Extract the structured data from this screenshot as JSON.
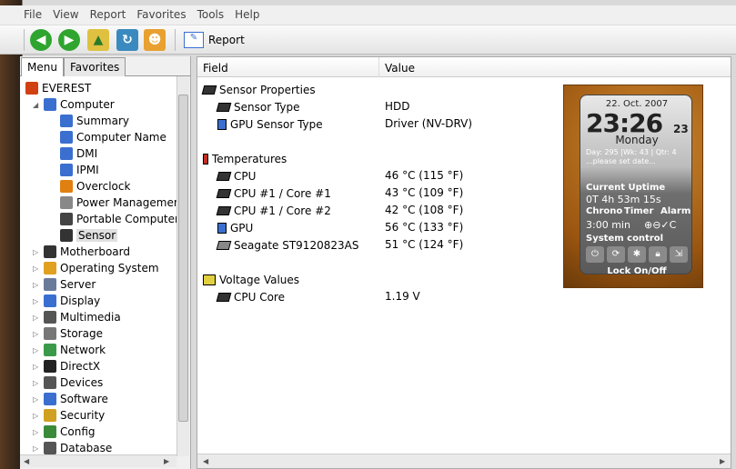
{
  "menu": [
    "File",
    "View",
    "Report",
    "Favorites",
    "Tools",
    "Help"
  ],
  "toolbar": {
    "report_label": "Report"
  },
  "left_tabs": [
    "Menu",
    "Favorites"
  ],
  "tree": [
    {
      "label": "EVEREST",
      "level": 0,
      "icon": "info-icon",
      "color": "#d04010"
    },
    {
      "label": "Computer",
      "level": 1,
      "icon": "computer-icon",
      "color": "#3a6fd0",
      "exp": "◢"
    },
    {
      "label": "Summary",
      "level": 2,
      "icon": "info-icon",
      "color": "#3a6fd0"
    },
    {
      "label": "Computer Name",
      "level": 2,
      "icon": "computer-icon",
      "color": "#3a6fd0"
    },
    {
      "label": "DMI",
      "level": 2,
      "icon": "computer-icon",
      "color": "#3a6fd0"
    },
    {
      "label": "IPMI",
      "level": 2,
      "icon": "computer-icon",
      "color": "#3a6fd0"
    },
    {
      "label": "Overclock",
      "level": 2,
      "icon": "fire-icon",
      "color": "#e08010"
    },
    {
      "label": "Power Management",
      "level": 2,
      "icon": "power-icon",
      "color": "#888"
    },
    {
      "label": "Portable Computer",
      "level": 2,
      "icon": "laptop-icon",
      "color": "#444"
    },
    {
      "label": "Sensor",
      "level": 2,
      "icon": "sensor-icon",
      "color": "#333",
      "selected": true
    },
    {
      "label": "Motherboard",
      "level": 1,
      "icon": "chip-icon",
      "color": "#333",
      "exp": "▷"
    },
    {
      "label": "Operating System",
      "level": 1,
      "icon": "windows-icon",
      "color": "#e0a020",
      "exp": "▷"
    },
    {
      "label": "Server",
      "level": 1,
      "icon": "server-icon",
      "color": "#6a7a9a",
      "exp": "▷"
    },
    {
      "label": "Display",
      "level": 1,
      "icon": "display-icon",
      "color": "#3a6fd0",
      "exp": "▷"
    },
    {
      "label": "Multimedia",
      "level": 1,
      "icon": "speaker-icon",
      "color": "#555",
      "exp": "▷"
    },
    {
      "label": "Storage",
      "level": 1,
      "icon": "disk-icon",
      "color": "#777",
      "exp": "▷"
    },
    {
      "label": "Network",
      "level": 1,
      "icon": "network-icon",
      "color": "#3a9a4a",
      "exp": "▷"
    },
    {
      "label": "DirectX",
      "level": 1,
      "icon": "directx-icon",
      "color": "#222",
      "exp": "▷"
    },
    {
      "label": "Devices",
      "level": 1,
      "icon": "devices-icon",
      "color": "#555",
      "exp": "▷"
    },
    {
      "label": "Software",
      "level": 1,
      "icon": "software-icon",
      "color": "#3a6fd0",
      "exp": "▷"
    },
    {
      "label": "Security",
      "level": 1,
      "icon": "shield-icon",
      "color": "#d0a020",
      "exp": "▷"
    },
    {
      "label": "Config",
      "level": 1,
      "icon": "config-icon",
      "color": "#3a8a3a",
      "exp": "▷"
    },
    {
      "label": "Database",
      "level": 1,
      "icon": "database-icon",
      "color": "#555",
      "exp": "▷"
    }
  ],
  "columns": {
    "field": "Field",
    "value": "Value"
  },
  "rows": [
    {
      "type": "section",
      "field": "Sensor Properties",
      "icon": "sensor-icon"
    },
    {
      "type": "item",
      "field": "Sensor Type",
      "value": "HDD",
      "icon": "sensor-icon"
    },
    {
      "type": "item",
      "field": "GPU Sensor Type",
      "value": "Driver  (NV-DRV)",
      "icon": "computer-icon"
    },
    {
      "type": "gap"
    },
    {
      "type": "section",
      "field": "Temperatures",
      "icon": "thermometer-icon"
    },
    {
      "type": "item",
      "field": "CPU",
      "value": "46 °C  (115 °F)",
      "icon": "chip-icon"
    },
    {
      "type": "item",
      "field": "CPU #1 / Core #1",
      "value": "43 °C  (109 °F)",
      "icon": "chip-icon"
    },
    {
      "type": "item",
      "field": "CPU #1 / Core #2",
      "value": "42 °C  (108 °F)",
      "icon": "chip-icon"
    },
    {
      "type": "item",
      "field": "GPU",
      "value": "56 °C  (133 °F)",
      "icon": "computer-icon"
    },
    {
      "type": "item",
      "field": "Seagate ST9120823AS",
      "value": "51 °C  (124 °F)",
      "icon": "disk-icon"
    },
    {
      "type": "gap"
    },
    {
      "type": "section",
      "field": "Voltage Values",
      "icon": "voltage-icon"
    },
    {
      "type": "item",
      "field": "CPU Core",
      "value": "1.19 V",
      "icon": "chip-icon"
    }
  ],
  "gadget": {
    "date": "22. Oct. 2007",
    "time": "23:26",
    "seconds": "23",
    "day": "Monday",
    "info1": "Day: 295 |Wk: 43 | Qtr: 4",
    "info2": "...please set date...",
    "uptime_label": "Current Uptime",
    "uptime": "0T 4h 53m 15s",
    "chrono": "Chrono",
    "timer": "Timer",
    "alarm": "Alarm",
    "timer_value": "3:00 min",
    "timer_controls": "⊕⊖✓C",
    "system_control": "System control",
    "lock": "Lock On/Off"
  }
}
